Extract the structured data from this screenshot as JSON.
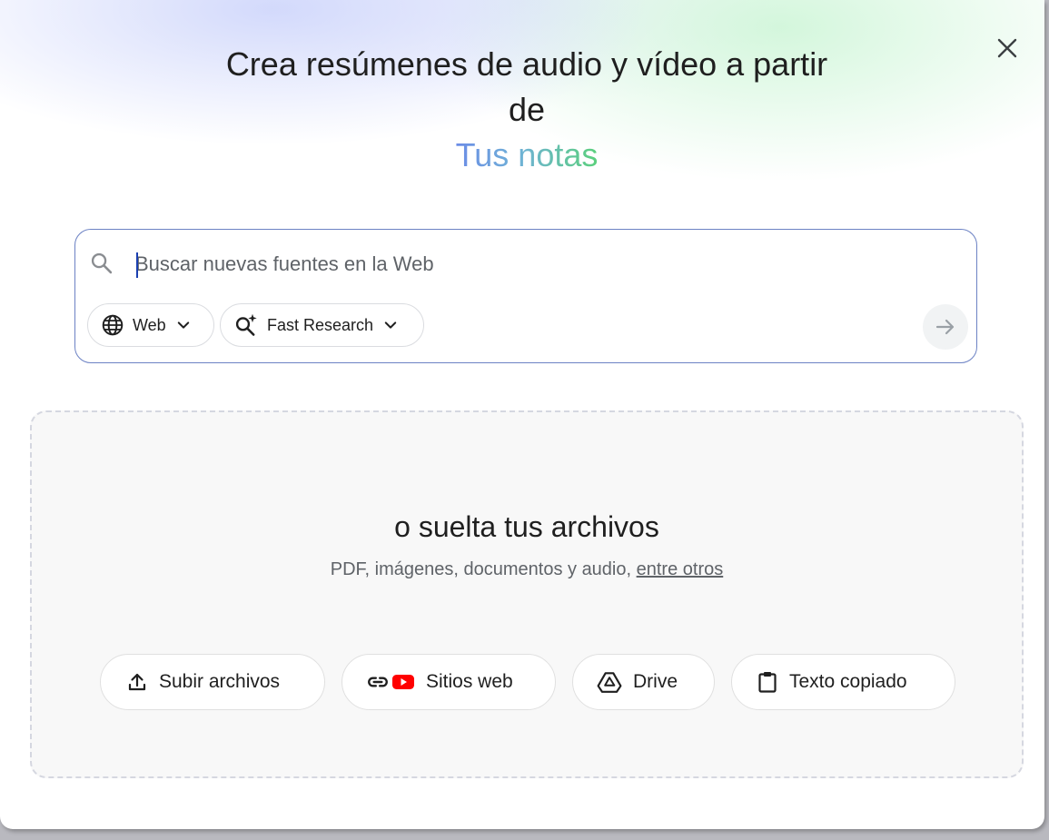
{
  "dialog": {
    "heading_line1": "Crea resúmenes de audio y vídeo a partir",
    "heading_line2": "de",
    "heading_accent": "Tus notas"
  },
  "search": {
    "placeholder": "Buscar nuevas fuentes en la Web",
    "source_chip_label": "Web",
    "mode_chip_label": "Fast Research"
  },
  "dropzone": {
    "title": "o suelta tus archivos",
    "subtitle": "PDF, imágenes, documentos y audio,",
    "subtitle_link": "entre otros"
  },
  "sources": [
    {
      "label": "Subir archivos",
      "icon": "upload-icon"
    },
    {
      "label": "Sitios web",
      "icon": "link-youtube-icon"
    },
    {
      "label": "Drive",
      "icon": "drive-icon"
    },
    {
      "label": "Texto copiado",
      "icon": "clipboard-icon"
    }
  ],
  "colors": {
    "accent_start": "#6b8ce6",
    "accent_end": "#5bd07d",
    "search_border": "#6c82c4",
    "youtube_red": "#ff0000"
  }
}
